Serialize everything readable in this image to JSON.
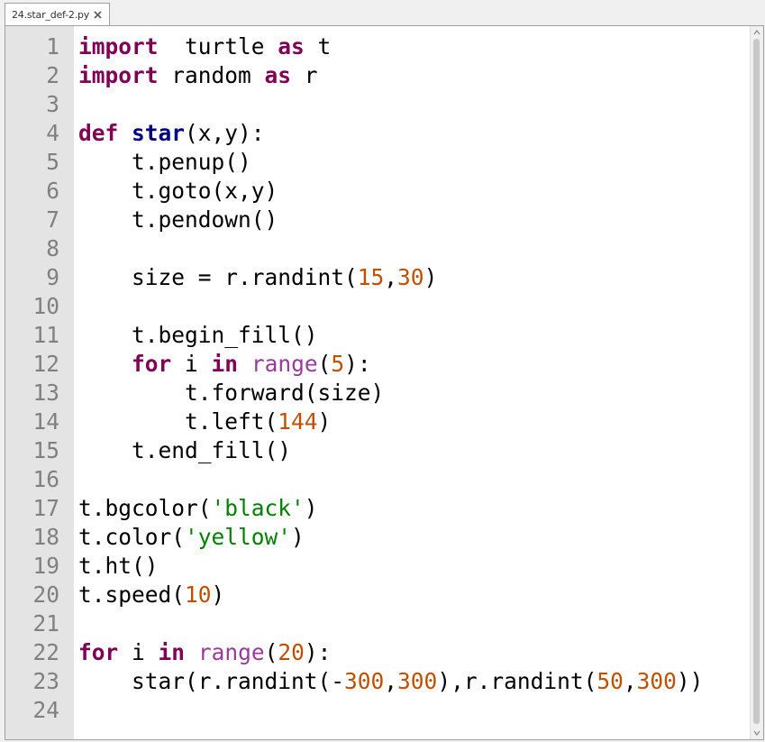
{
  "tab": {
    "title": "24.star_def-2.py"
  },
  "lines": [
    {
      "n": "1",
      "seg": [
        [
          "kw",
          "import"
        ],
        [
          "",
          "  turtle "
        ],
        [
          "kw",
          "as"
        ],
        [
          "",
          " t"
        ]
      ]
    },
    {
      "n": "2",
      "seg": [
        [
          "kw",
          "import"
        ],
        [
          "",
          " random "
        ],
        [
          "kw",
          "as"
        ],
        [
          "",
          " r"
        ]
      ]
    },
    {
      "n": "3",
      "seg": []
    },
    {
      "n": "4",
      "seg": [
        [
          "kw",
          "def"
        ],
        [
          "",
          " "
        ],
        [
          "kw2",
          "star"
        ],
        [
          "",
          "(x,y):"
        ]
      ]
    },
    {
      "n": "5",
      "seg": [
        [
          "",
          "    t.penup()"
        ]
      ]
    },
    {
      "n": "6",
      "seg": [
        [
          "",
          "    t.goto(x,y)"
        ]
      ]
    },
    {
      "n": "7",
      "seg": [
        [
          "",
          "    t.pendown()"
        ]
      ]
    },
    {
      "n": "8",
      "seg": []
    },
    {
      "n": "9",
      "seg": [
        [
          "",
          "    size = r.randint("
        ],
        [
          "num",
          "15"
        ],
        [
          "",
          ","
        ],
        [
          "num",
          "30"
        ],
        [
          "",
          ")"
        ]
      ]
    },
    {
      "n": "10",
      "seg": []
    },
    {
      "n": "11",
      "seg": [
        [
          "",
          "    t.begin_fill()"
        ]
      ]
    },
    {
      "n": "12",
      "seg": [
        [
          "",
          "    "
        ],
        [
          "kw",
          "for"
        ],
        [
          "",
          " i "
        ],
        [
          "kw",
          "in"
        ],
        [
          "",
          " "
        ],
        [
          "builtin",
          "range"
        ],
        [
          "",
          "("
        ],
        [
          "num",
          "5"
        ],
        [
          "",
          "):"
        ]
      ]
    },
    {
      "n": "13",
      "seg": [
        [
          "",
          "        t.forward(size)"
        ]
      ]
    },
    {
      "n": "14",
      "seg": [
        [
          "",
          "        t.left("
        ],
        [
          "num",
          "144"
        ],
        [
          "",
          ")"
        ]
      ]
    },
    {
      "n": "15",
      "seg": [
        [
          "",
          "    t.end_fill()"
        ]
      ]
    },
    {
      "n": "16",
      "seg": []
    },
    {
      "n": "17",
      "seg": [
        [
          "",
          "t.bgcolor("
        ],
        [
          "str",
          "'black'"
        ],
        [
          "",
          ")"
        ]
      ]
    },
    {
      "n": "18",
      "seg": [
        [
          "",
          "t.color("
        ],
        [
          "str",
          "'yellow'"
        ],
        [
          "",
          ")"
        ]
      ]
    },
    {
      "n": "19",
      "seg": [
        [
          "",
          "t.ht()"
        ]
      ]
    },
    {
      "n": "20",
      "seg": [
        [
          "",
          "t.speed("
        ],
        [
          "num",
          "10"
        ],
        [
          "",
          ")"
        ]
      ]
    },
    {
      "n": "21",
      "seg": []
    },
    {
      "n": "22",
      "seg": [
        [
          "kw",
          "for"
        ],
        [
          "",
          " i "
        ],
        [
          "kw",
          "in"
        ],
        [
          "",
          " "
        ],
        [
          "builtin",
          "range"
        ],
        [
          "",
          "("
        ],
        [
          "num",
          "20"
        ],
        [
          "",
          "):"
        ]
      ]
    },
    {
      "n": "23",
      "seg": [
        [
          "",
          "    star(r.randint(-"
        ],
        [
          "num",
          "300"
        ],
        [
          "",
          ","
        ],
        [
          "num",
          "300"
        ],
        [
          "",
          "),r.randint("
        ],
        [
          "num",
          "50"
        ],
        [
          "",
          ","
        ],
        [
          "num",
          "300"
        ],
        [
          "",
          "))"
        ]
      ]
    },
    {
      "n": "24",
      "seg": []
    }
  ],
  "icons": {
    "tab_close": "close-icon",
    "scroll_up": "chevron-up-icon",
    "scroll_down": "chevron-down-icon"
  }
}
